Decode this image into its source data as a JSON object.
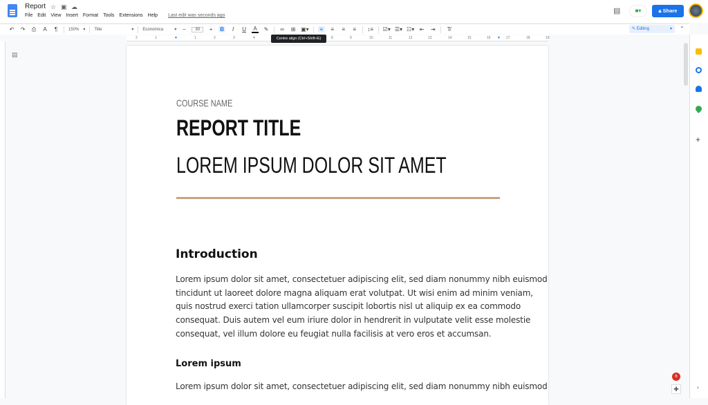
{
  "header": {
    "title": "Report",
    "menu": [
      "File",
      "Edit",
      "View",
      "Insert",
      "Format",
      "Tools",
      "Extensions",
      "Help"
    ],
    "last_edit": "Last edit was seconds ago",
    "share_label": "Share"
  },
  "toolbar": {
    "zoom": "150%",
    "style": "Title",
    "font": "Economica",
    "font_size": "30",
    "tooltip": "Centre align (Ctrl+Shift+E)",
    "mode": "Editing"
  },
  "ruler": [
    "2",
    "1",
    "1",
    "2",
    "3",
    "4",
    "5",
    "6",
    "7",
    "8",
    "9",
    "10",
    "11",
    "12",
    "13",
    "14",
    "15",
    "16",
    "17",
    "18",
    "19"
  ],
  "document": {
    "course_name": "COURSE NAME",
    "report_title": "REPORT TITLE",
    "subtitle": "LOREM IPSUM DOLOR SIT AMET",
    "section1_heading": "Introduction",
    "section1_lines": [
      "Lorem ipsum dolor sit amet, consectetuer adipiscing elit, sed diam nonummy nibh euismod",
      "tincidunt ut laoreet dolore magna aliquam erat volutpat. Ut wisi enim ad minim veniam,",
      "quis nostrud exerci tation ullamcorper suscipit lobortis nisl ut aliquip ex ea commodo",
      "consequat. Duis autem vel eum iriure dolor in hendrerit in vulputate velit esse molestie",
      "consequat, vel illum dolore eu feugiat nulla facilisis at vero eros et accumsan."
    ],
    "section2_heading": "Lorem ipsum",
    "section2_lines": [
      "Lorem ipsum dolor sit amet, consectetuer adipiscing elit, sed diam nonummy nibh euismod"
    ]
  },
  "notifications": {
    "count": "6"
  },
  "colors": {
    "accent": "#1a73e8",
    "rule": "#c8a47e"
  }
}
